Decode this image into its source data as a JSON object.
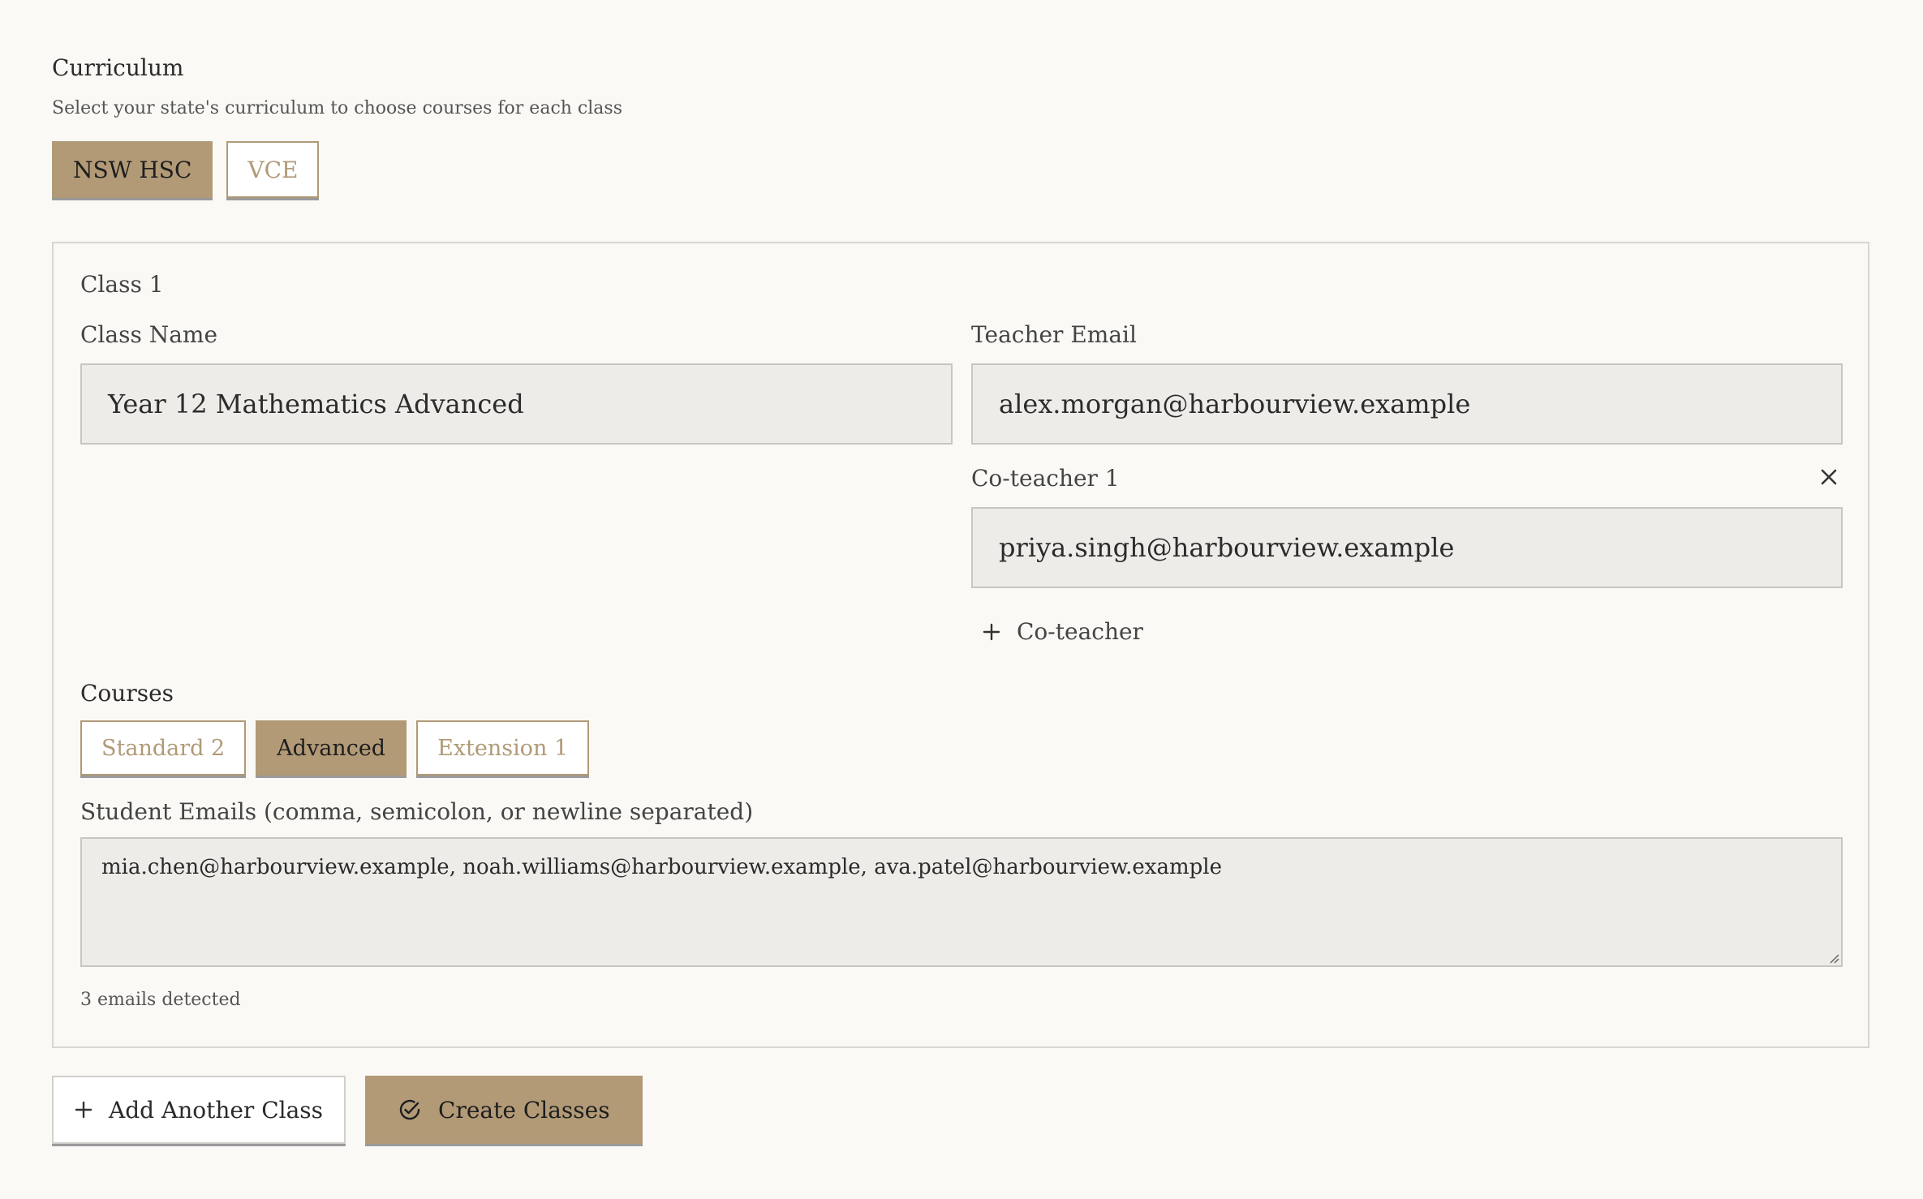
{
  "curriculum": {
    "title": "Curriculum",
    "subtitle": "Select your state's curriculum to choose courses for each class",
    "options": [
      {
        "label": "NSW HSC",
        "selected": true
      },
      {
        "label": "VCE",
        "selected": false
      }
    ]
  },
  "class_card": {
    "label": "Class 1",
    "class_name_label": "Class Name",
    "class_name_value": "Year 12 Mathematics Advanced",
    "teacher_email_label": "Teacher Email",
    "teacher_email_value": "alex.morgan@harbourview.example",
    "coteacher_label": "Co-teacher 1",
    "coteacher_value": "priya.singh@harbourview.example",
    "add_coteacher_label": "Co-teacher",
    "courses_label": "Courses",
    "courses": [
      {
        "label": "Standard 2",
        "selected": false
      },
      {
        "label": "Advanced",
        "selected": true
      },
      {
        "label": "Extension 1",
        "selected": false
      }
    ],
    "student_emails_label": "Student Emails (comma, semicolon, or newline separated)",
    "student_emails_value": "mia.chen@harbourview.example, noah.williams@harbourview.example, ava.patel@harbourview.example",
    "emails_detected": "3 emails detected"
  },
  "actions": {
    "add_class_label": "Add Another Class",
    "create_label": "Create Classes"
  },
  "colors": {
    "accent": "#b29a77",
    "background": "#faf9f6",
    "input_bg": "#edece9"
  },
  "icons": {
    "close": "close-icon",
    "plus": "plus-icon",
    "check_circle": "check-circle-icon"
  }
}
